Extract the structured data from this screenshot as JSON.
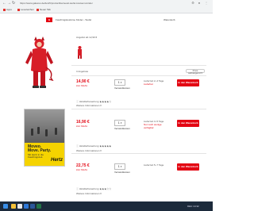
{
  "browser": {
    "back_icon": "arrow-left-icon",
    "forward_icon": "arrow-right-icon",
    "reload_icon": "reload-icon",
    "url": "https://www.galaxus.de/de/s5/product/karneval-teufel-kostuem-kinder",
    "extensions_icon": "puzzle-icon",
    "menu_icon": "kebab-menu-icon",
    "bookmarks": [
      "Apps",
      "Lesezeichen",
      "Neuer Tab"
    ]
  },
  "site": {
    "logo": "G",
    "breadcrumb": "Faschingskostüme Kinder › Teufel",
    "header_link": "Warenkorb"
  },
  "listing": {
    "summary_line": "Angebot ab 12,90 €",
    "result_count": "3 Angebote",
    "sort_label": "Preis aufsteigend ▾",
    "offers": [
      {
        "price": "14,90 €",
        "price_note": "inkl. MwSt.",
        "quantity": "1",
        "shipping_link": "Versandkosten",
        "stock": "Lieferzeit 2–4 Tage",
        "stock_sub": "Lieferbar",
        "button": "In den Warenkorb",
        "meta": "Händlerbewertung ★★★★☆",
        "meta2": "Weitere Informationen ▾"
      },
      {
        "price": "16,90 €",
        "price_note": "inkl. MwSt.",
        "quantity": "1",
        "shipping_link": "Versandkosten",
        "stock": "Lieferzeit 3–5 Tage",
        "stock_sub": "Nur noch wenige verfügbar",
        "button": "In den Warenkorb",
        "meta": "Händlerbewertung ★★★★★",
        "meta2": "Weitere Informationen ▾"
      },
      {
        "price": "22,75 €",
        "price_note": "inkl. MwSt.",
        "quantity": "1",
        "shipping_link": "Versandkosten",
        "stock": "Lieferzeit 5–7 Tage",
        "stock_sub": "",
        "button": "In den Warenkorb",
        "meta": "Händlerbewertung ★★★☆☆",
        "meta2": "Weitere Informationen ▾"
      }
    ]
  },
  "ad": {
    "headline": "Moveo. Move. Party.",
    "subline": "Mit Hertz in die Faschingszeit.",
    "brand": "Hertz"
  },
  "taskbar": {
    "start_icon": "windows-start-icon",
    "apps": [
      "file-explorer-icon",
      "chrome-icon",
      "mail-icon",
      "word-icon",
      "excel-icon"
    ],
    "tray_text": "DEU 14:32"
  },
  "colors": {
    "accent": "#e30613",
    "ad_yellow": "#f5d300",
    "taskbar": "#1c2a3b"
  }
}
